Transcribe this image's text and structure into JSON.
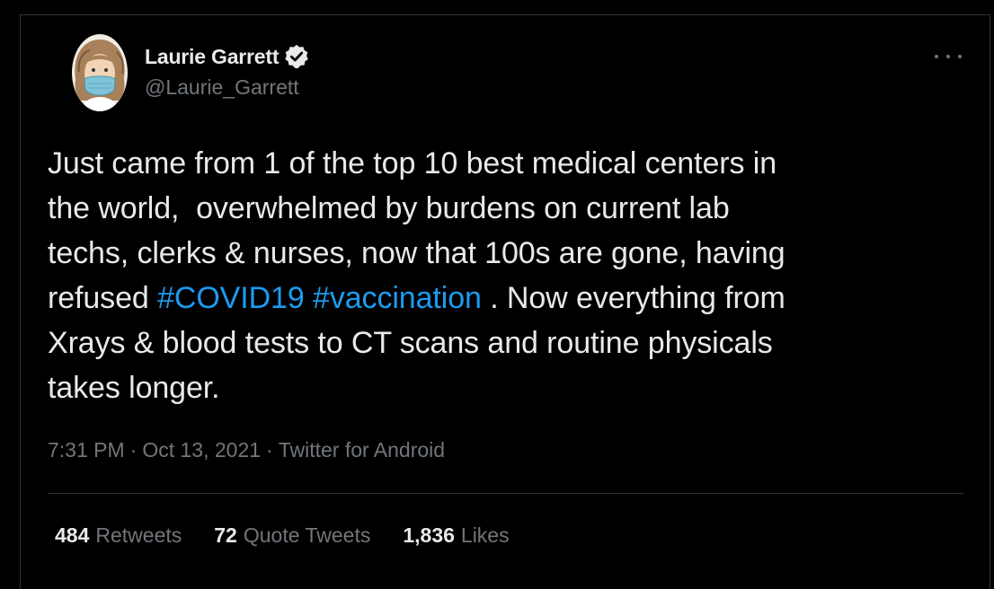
{
  "tweet": {
    "author": {
      "name": "Laurie Garrett",
      "handle": "@Laurie_Garrett",
      "verified": true
    },
    "text_segments": [
      {
        "text": "Just came from 1 of the top 10 best medical centers in\nthe world,  overwhelmed by burdens on current lab\ntechs, clerks & nurses, now that 100s are gone, having\nrefused ",
        "type": "text"
      },
      {
        "text": "#COVID19",
        "type": "hashtag"
      },
      {
        "text": " ",
        "type": "text"
      },
      {
        "text": "#vaccination",
        "type": "hashtag"
      },
      {
        "text": " . Now everything from\nXrays & blood tests to CT scans and routine physicals\ntakes longer.",
        "type": "text"
      }
    ],
    "time": "7:31 PM",
    "date": "Oct 13, 2021",
    "separator": "·",
    "source": "Twitter for Android",
    "stats": {
      "retweets": {
        "count": "484",
        "label": "Retweets"
      },
      "quotes": {
        "count": "72",
        "label": "Quote Tweets"
      },
      "likes": {
        "count": "1,836",
        "label": "Likes"
      }
    }
  },
  "icons": {
    "verified": "verified-badge-icon",
    "more": "more-options-icon"
  },
  "colors": {
    "background": "#000000",
    "text": "#e7e9ea",
    "secondary": "#71767b",
    "link": "#1d9bf0",
    "border": "#2f3336"
  }
}
